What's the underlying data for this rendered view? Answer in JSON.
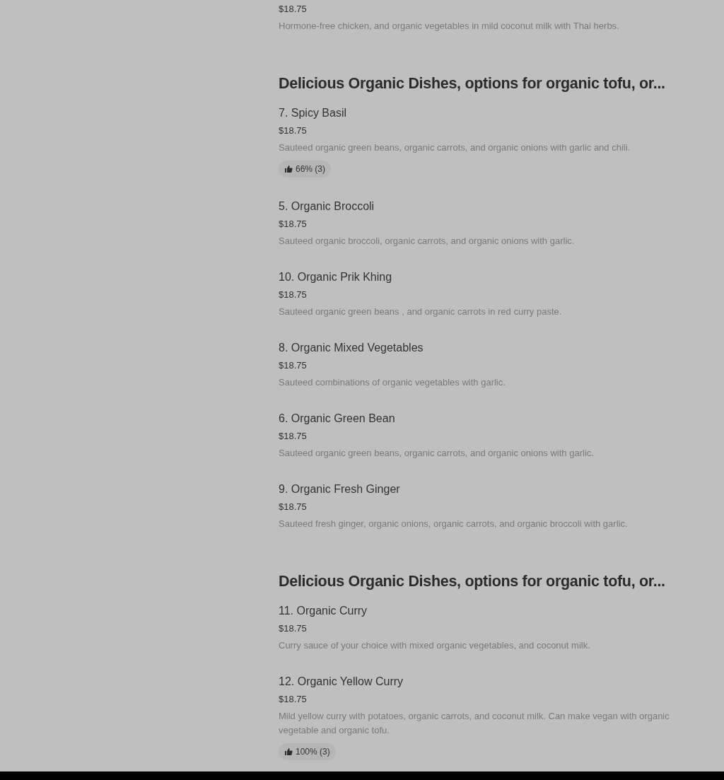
{
  "sections": [
    {
      "items": [
        {
          "price": "$18.75",
          "description": "Hormone-free chicken, and organic vegetables in mild coconut milk with Thai herbs."
        }
      ]
    },
    {
      "heading": "Delicious Organic Dishes, options for organic tofu, or...",
      "items": [
        {
          "title": "7. Spicy Basil",
          "price": "$18.75",
          "description": "Sauteed organic green beans, organic carrots, and organic onions with garlic and chili.",
          "rating": "66% (3)"
        },
        {
          "title": "5. Organic Broccoli",
          "price": "$18.75",
          "description": "Sauteed organic broccoli, organic carrots, and organic onions with garlic."
        },
        {
          "title": "10. Organic Prik Khing",
          "price": "$18.75",
          "description": "Sauteed organic green beans , and organic carrots in red curry paste."
        },
        {
          "title": "8. Organic Mixed Vegetables",
          "price": "$18.75",
          "description": "Sauteed combinations of organic vegetables with garlic."
        },
        {
          "title": "6. Organic Green Bean",
          "price": "$18.75",
          "description": "Sauteed organic green beans, organic carrots, and organic onions with garlic."
        },
        {
          "title": "9. Organic Fresh Ginger",
          "price": "$18.75",
          "description": "Sauteed fresh ginger, organic onions, organic carrots, and organic broccoli with garlic."
        }
      ]
    },
    {
      "heading": "Delicious Organic Dishes, options for organic tofu, or...",
      "items": [
        {
          "title": "11. Organic Curry",
          "price": "$18.75",
          "description": "Curry sauce of your choice with mixed organic vegetables, and coconut milk."
        },
        {
          "title": "12. Organic Yellow Curry",
          "price": "$18.75",
          "description": "Mild yellow curry with potatoes, organic carrots, and coconut milk. Can make vegan with organic vegetable and organic tofu.",
          "rating": "100% (3)"
        }
      ]
    }
  ]
}
